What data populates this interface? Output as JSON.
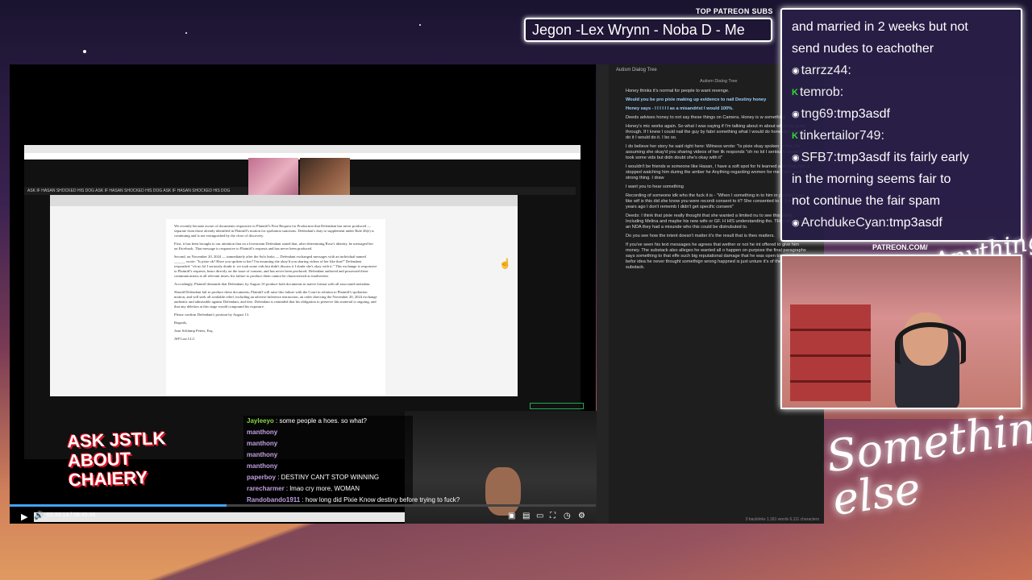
{
  "patreon_subs": {
    "title": "TOP PATREON SUBS",
    "names": "Jegon -Lex Wrynn -  Noba D - Me"
  },
  "player": {
    "time": "02:33:13 / 06:45:46",
    "progress_fraction": 0.37,
    "tabs": "ASK IF HASAN SHOCKED HIS DOG  ASK IF HASAN SHOCKED HIS DOG  ASK IF HASAN SHOCKED HIS DOG",
    "overlay_text": "ASK JSTLK ABOUT CHAIERY"
  },
  "document": {
    "paragraphs": [
      "We recently became aware of documents responsive to Plaintiff's First Request for Production that Defendant has never produced — separate from those already identified in Plaintiff's motion for spoliation sanctions. Defendant's duty to supplement under Rule 26(e) is continuing and is not extinguished by the close of discovery.",
      "First, it has been brought to our attention that on a livestream Defendant stated that, after determining Rose's identity, he messaged her on Facebook. That message is responsive to Plaintiff's requests and has never been produced.",
      "Second, on November 20, 2024 — immediately after the Solo leaks — Defendant exchanged messages with an individual named ______ wrote: \"Is pixie ok? Have you spoken to her? I'm assuming she okay'd you sharing videos of her like that?\" Defendant responded: \"oh no lol I seriously doubt it. we took some vids but didn't discuss it I doubt she's okay with it.\" This exchange is responsive to Plaintiff's requests, bears directly on the issue of consent, and has never been produced. Defendant authored and possessed these communications at all relevant times; his failure to produce them cannot be characterized as inadvertent.",
      "Accordingly, Plaintiff demands that Defendant, by August 10 produce both documents in native format with all associated metadata.",
      "Should Defendant fail to produce these documents, Plaintiff will raise this failure with the Court in relation to Plaintiff's spoliation motion, and will seek all available relief, including an adverse-inference instruction, an order directing the November 20, 2024 exchange authentic and admissible against Defendant, and fees. Defendant is reminded that his obligation to preserve this material is ongoing, and that any deletion at this stage would compound his exposure.",
      "Please confirm Defendant's position by August 13.",
      "Regards,",
      "Joan Schlump Peters, Esq.",
      "JSP Law LLC"
    ]
  },
  "video_chat": [
    {
      "user": "Jayleeyo",
      "msg": ": some people a hoes. so what?"
    },
    {
      "user": "manthony",
      "msg": ""
    },
    {
      "user": "manthony",
      "msg": ""
    },
    {
      "user": "manthony",
      "msg": ""
    },
    {
      "user": "manthony",
      "msg": ""
    },
    {
      "user": "paperboy",
      "msg": ": DESTINY CAN'T STOP WINNING"
    },
    {
      "user": "rarecharmer",
      "msg": ": lmao cry more, WOMAN"
    },
    {
      "user": "Randobando1911",
      "msg": ": how long did Pixie Know destiny before trying to fuck?"
    }
  ],
  "notes": {
    "title": "Autism Dialog Tree",
    "tab": "Autism Dialog Tree",
    "lines": [
      "Honey thinks it's normal for people to want revenge.",
      "Would you be pro pixie making up evidence to nail Destiny honey",
      "Honey says - I I I I I I as a misandrist I would 100%.",
      "Deeds advises honey to not say these things on Camera. Honey is w something.",
      "Honey's mic works again. So what I was saying if I'm talking about m about what I've gone through. If I knew I could nail the guy by fabri something what I would do honestly I would do it I would do it. I bo so.",
      "I do believe her story he said right here: Witness wrote: \"Is pixie okay spoken to her, I'm assuming she okay'd you sharing videos of her lik responds \"oh no lol I seriously doubt it we took some vids but didn doubt she's okay with it\"",
      "I wouldn't be friends w someone like Hasan, I have a soft spot for hi learned a lot from him. I stopped watching him during the amber he Anything regarding women for me that's such a strong thing. I draw",
      "I want you to hear something",
      "Recording of someone idk who the fuck it is - \"When I something in to him in person I was like wtf is this did she know you were recordi consent to it? She consented to it. It was 3 years ago I don't rememb I didn't get specific consent\"",
      "Deeds: I think that pixie really thought that she wanted a limited nu to see this video. Including Melina and maybe his new wife or GF. H HIS understanding tho. THey didn't get an NDA they had a misunde who this could be distrubuted to.",
      "Do you see how the intent doesn't matter it's the result that is theo matters.",
      "If you've seen his text messages he agrees that wether or not he int offered to give him money. The substack also alleges he wanted all o happen on purpose the final paragraphs says something to that effe such big reputational damage that he was open to negotiating befor idea he never thought somethign wrong happned is just unture it's of the damaging substack."
    ],
    "status": "0 backlinks   1,181 words  6,111 characters"
  },
  "twitch_chat": [
    {
      "badge": "",
      "user": "",
      "msg": "and married in 2 weeks but not"
    },
    {
      "badge": "",
      "user": "",
      "msg": "send nudes to eachother"
    },
    {
      "badge": "◉",
      "user": "tarrzz44:",
      "msg": ""
    },
    {
      "badge": "K",
      "user": "temrob:",
      "msg": ""
    },
    {
      "badge": "◉",
      "user": "tng69:",
      "msg": "tmp3asdf"
    },
    {
      "badge": "K",
      "user": "tinkertailor749:",
      "msg": ""
    },
    {
      "badge": "◉",
      "user": "SFB7:",
      "msg": "tmp3asdf its fairly early"
    },
    {
      "badge": "",
      "user": "",
      "msg": "in the morning       seems fair to"
    },
    {
      "badge": "",
      "user": "",
      "msg": "not continue the fair     spam"
    },
    {
      "badge": "◉",
      "user": "ArchdukeCyan:",
      "msg": "tmp3asdf"
    }
  ],
  "patreon_url": "PATREON.COM/",
  "signature_small": "Anything else",
  "signature_big": "Something else"
}
